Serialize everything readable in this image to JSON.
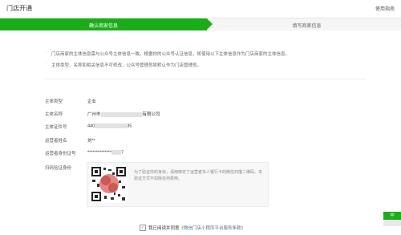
{
  "header": {
    "title": "门店开通",
    "help": "使用指南"
  },
  "steps": [
    {
      "label": "确认商家信息"
    },
    {
      "label": "填写商家信息"
    }
  ],
  "notices": [
    "门店商家的主体信息需与公众号主体信息一致。根据你的公众号认证信息，将使用以下主体信息作为门店商家的主体信息。",
    "主体类型、名称和相关信息不可修改，公众号管理员将默认作为门店管理员。"
  ],
  "fields": [
    {
      "label": "主体类型",
      "value": "企业"
    },
    {
      "label": "主体名称",
      "value_prefix": "广州市",
      "value_suffix": "有限公司"
    },
    {
      "label": "主体证件号",
      "value_prefix": "440",
      "value_suffix": "35"
    },
    {
      "label": "运营者姓名",
      "value": "刘**"
    },
    {
      "label": "运营者身份证号",
      "value_prefix": "**************",
      "value_suffix": "7"
    },
    {
      "label": "扫码验证身份"
    }
  ],
  "qr_hint": "为了验证你的身份，请用绑定了运营者本人银行卡的微信扫描二维码。本验证方式不扣除任何费用。",
  "agreement": {
    "check": "✓",
    "prefix": "我已阅读并同意",
    "link": "《微信门店小程序平台服务条款》"
  },
  "badge": {
    "text": "中"
  },
  "colors": {
    "accent": "#1aad19",
    "link": "#576b95"
  }
}
